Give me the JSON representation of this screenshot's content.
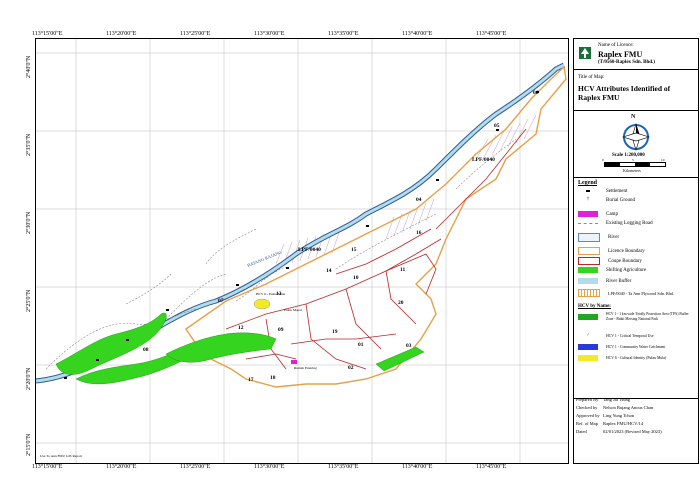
{
  "header": {
    "licence_label": "Name of Licence:",
    "licence_name": "Raplex FMU",
    "licence_sub": "(T/0560-Raplex Sdn. Bhd.)",
    "title_label": "Title of Map:",
    "title": "HCV Attributes Identified of Raplex FMU"
  },
  "scale": {
    "north": "N",
    "text": "Scale 1:200,000",
    "ticks": [
      "0",
      "5",
      "10"
    ],
    "unit": "Kilometers"
  },
  "coords": {
    "top": [
      "113°15'00\"E",
      "113°20'00\"E",
      "113°25'00\"E",
      "113°30'00\"E",
      "113°35'00\"E",
      "113°40'00\"E",
      "113°45'00\"E"
    ],
    "bottom": [
      "113°15'00\"E",
      "113°20'00\"E",
      "113°25'00\"E",
      "113°30'00\"E",
      "113°35'00\"E",
      "113°40'00\"E",
      "113°45'00\"E"
    ],
    "left": [
      "2°40'0\"N",
      "2°35'0\"N",
      "2°30'0\"N",
      "2°25'0\"N",
      "2°20'0\"N",
      "2°15'0\"N"
    ],
    "right": [
      "2°40'0\"N",
      "2°35'0\"N",
      "2°30'0\"N",
      "2°25'0\"N",
      "2°20'0\"N",
      "2°15'0\"N"
    ]
  },
  "legend": {
    "title": "Legend",
    "items": [
      "Settlement",
      "Burial Ground",
      "Camp",
      "Existing Logging Road",
      "River",
      "Licence Boundary",
      "Coupe Boundary",
      "Shifting Agriculture",
      "River Buffer",
      "LPF/0040 - Ta Ann Plywood Sdn. Bhd."
    ],
    "hcv_title": "HCV by Name:",
    "hcv_items": [
      "HCV 1 - 1 km wide Totally Protection Area (TPA) Buffer Zone - Bukit Mersing National Park",
      "HCV 1 - Critical Temporal Use",
      "HCV 1 - Community Water Catchment",
      "HCV 6 - Cultural Identity (Pulau Mula)"
    ]
  },
  "footer": {
    "rows": [
      {
        "k": "Prepared By",
        "v": "Tang Jia Tsung"
      },
      {
        "k": "Checked by",
        "v": "Nelson Bujang Anous Chan"
      },
      {
        "k": "Approved by",
        "v": "Ling Yung Tchon"
      },
      {
        "k": "Ref. of Map",
        "v": "Raplex FMU/HCV/14"
      },
      {
        "k": "Dated",
        "v": "02/01/2023 (Revised May 2023)"
      }
    ]
  },
  "map_labels": {
    "coupes": [
      "01",
      "02",
      "03",
      "04",
      "05",
      "06",
      "07",
      "08",
      "09",
      "10",
      "11",
      "12",
      "13",
      "14",
      "15",
      "16",
      "17",
      "18",
      "19",
      "20"
    ],
    "lpf_1": "LPF/0040",
    "lpf_2": "LPF/0040",
    "river_name": "BATANG RAJANG",
    "pulau_mula": "HCV 6 - Pulau Mula",
    "pulau_mapai": "Pulau Mapai",
    "rumah": "Rumah Ensiring",
    "credit": "Use To Ann FMU GIS Report"
  },
  "colors": {
    "licence": "#e6a04a",
    "coupe": "#b82626",
    "shifting": "#34d41f",
    "river_fill": "#b3dbe8",
    "river_edge": "#2a5a9a",
    "camp": "#e11fd8",
    "lpf": "#b87aa0",
    "road": "#8a8a8a"
  }
}
